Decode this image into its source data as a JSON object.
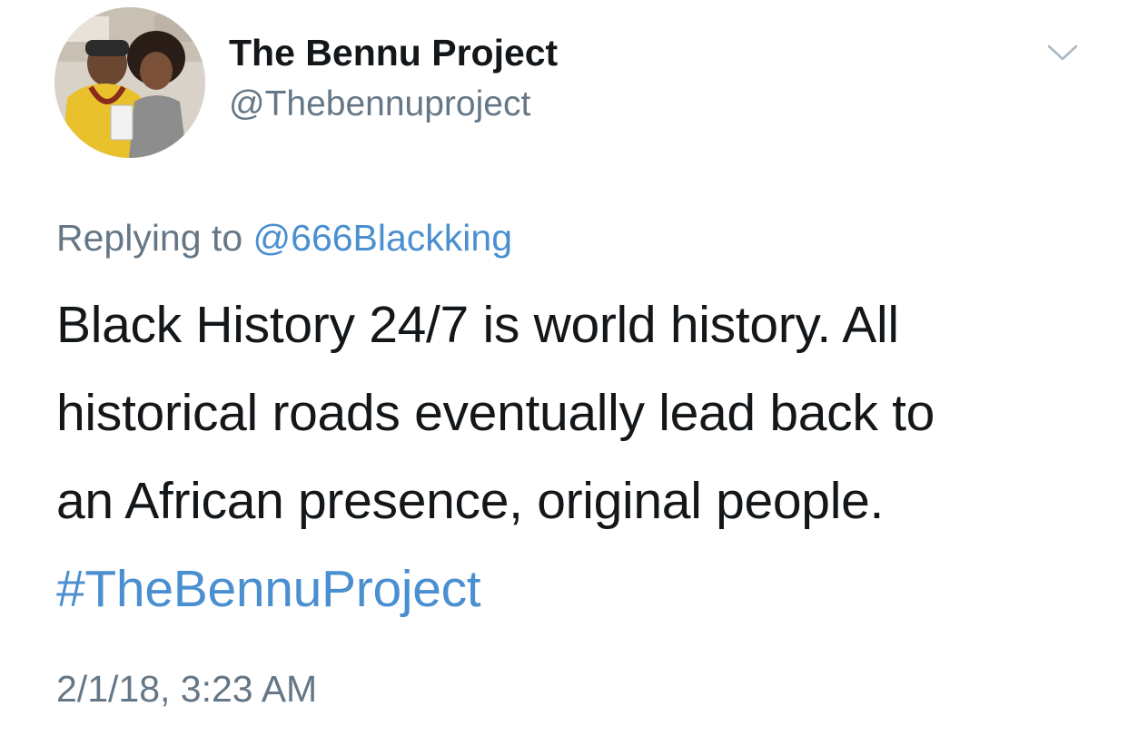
{
  "tweet": {
    "author": {
      "display_name": "The Bennu Project",
      "handle": "@Thebennuproject"
    },
    "reply": {
      "prefix": "Replying to ",
      "mention": "@666Blackking"
    },
    "text_lines": [
      "Black History 24/7 is world history. All",
      "historical roads eventually lead back to",
      "an African presence, original people."
    ],
    "hashtag": "#TheBennuProject",
    "timestamp": "2/1/18, 3:23 AM"
  },
  "icons": {
    "menu": "chevron-down-icon"
  },
  "colors": {
    "link": "#4a8fd0",
    "secondary_text": "#657786",
    "primary_text": "#14171a"
  }
}
